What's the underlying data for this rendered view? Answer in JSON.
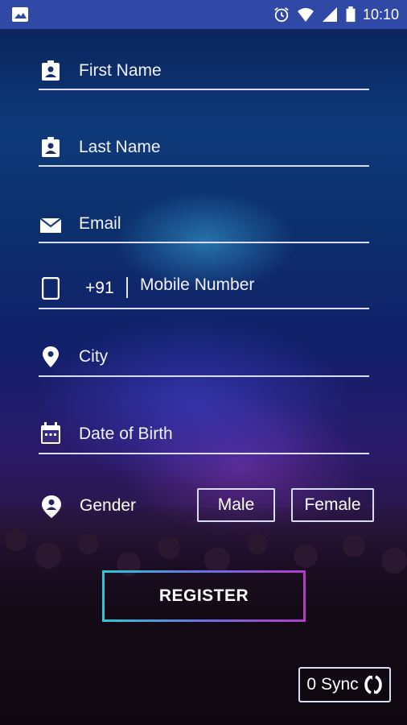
{
  "status_bar": {
    "time": "10:10",
    "icons": [
      "image-icon",
      "alarm-icon",
      "wifi-icon",
      "signal-icon",
      "battery-icon"
    ]
  },
  "form": {
    "first_name": {
      "placeholder": "First Name",
      "icon": "contact-card-icon"
    },
    "last_name": {
      "placeholder": "Last Name",
      "icon": "contact-card-icon"
    },
    "email": {
      "placeholder": "Email",
      "icon": "envelope-icon"
    },
    "mobile": {
      "country_code": "+91",
      "placeholder": "Mobile Number",
      "icon": "phone-icon"
    },
    "city": {
      "placeholder": "City",
      "icon": "location-pin-icon"
    },
    "dob": {
      "placeholder": "Date of Birth",
      "icon": "calendar-icon"
    },
    "gender": {
      "label": "Gender",
      "icon": "person-pin-icon",
      "options": [
        "Male",
        "Female"
      ]
    }
  },
  "actions": {
    "register_label": "REGISTER",
    "sync_count": "0",
    "sync_label": "Sync"
  },
  "colors": {
    "status_bar": "#3048a6",
    "underline": "#d9dcf2",
    "register_gradient_start": "#2ec6d6",
    "register_gradient_end": "#b53ac8"
  }
}
